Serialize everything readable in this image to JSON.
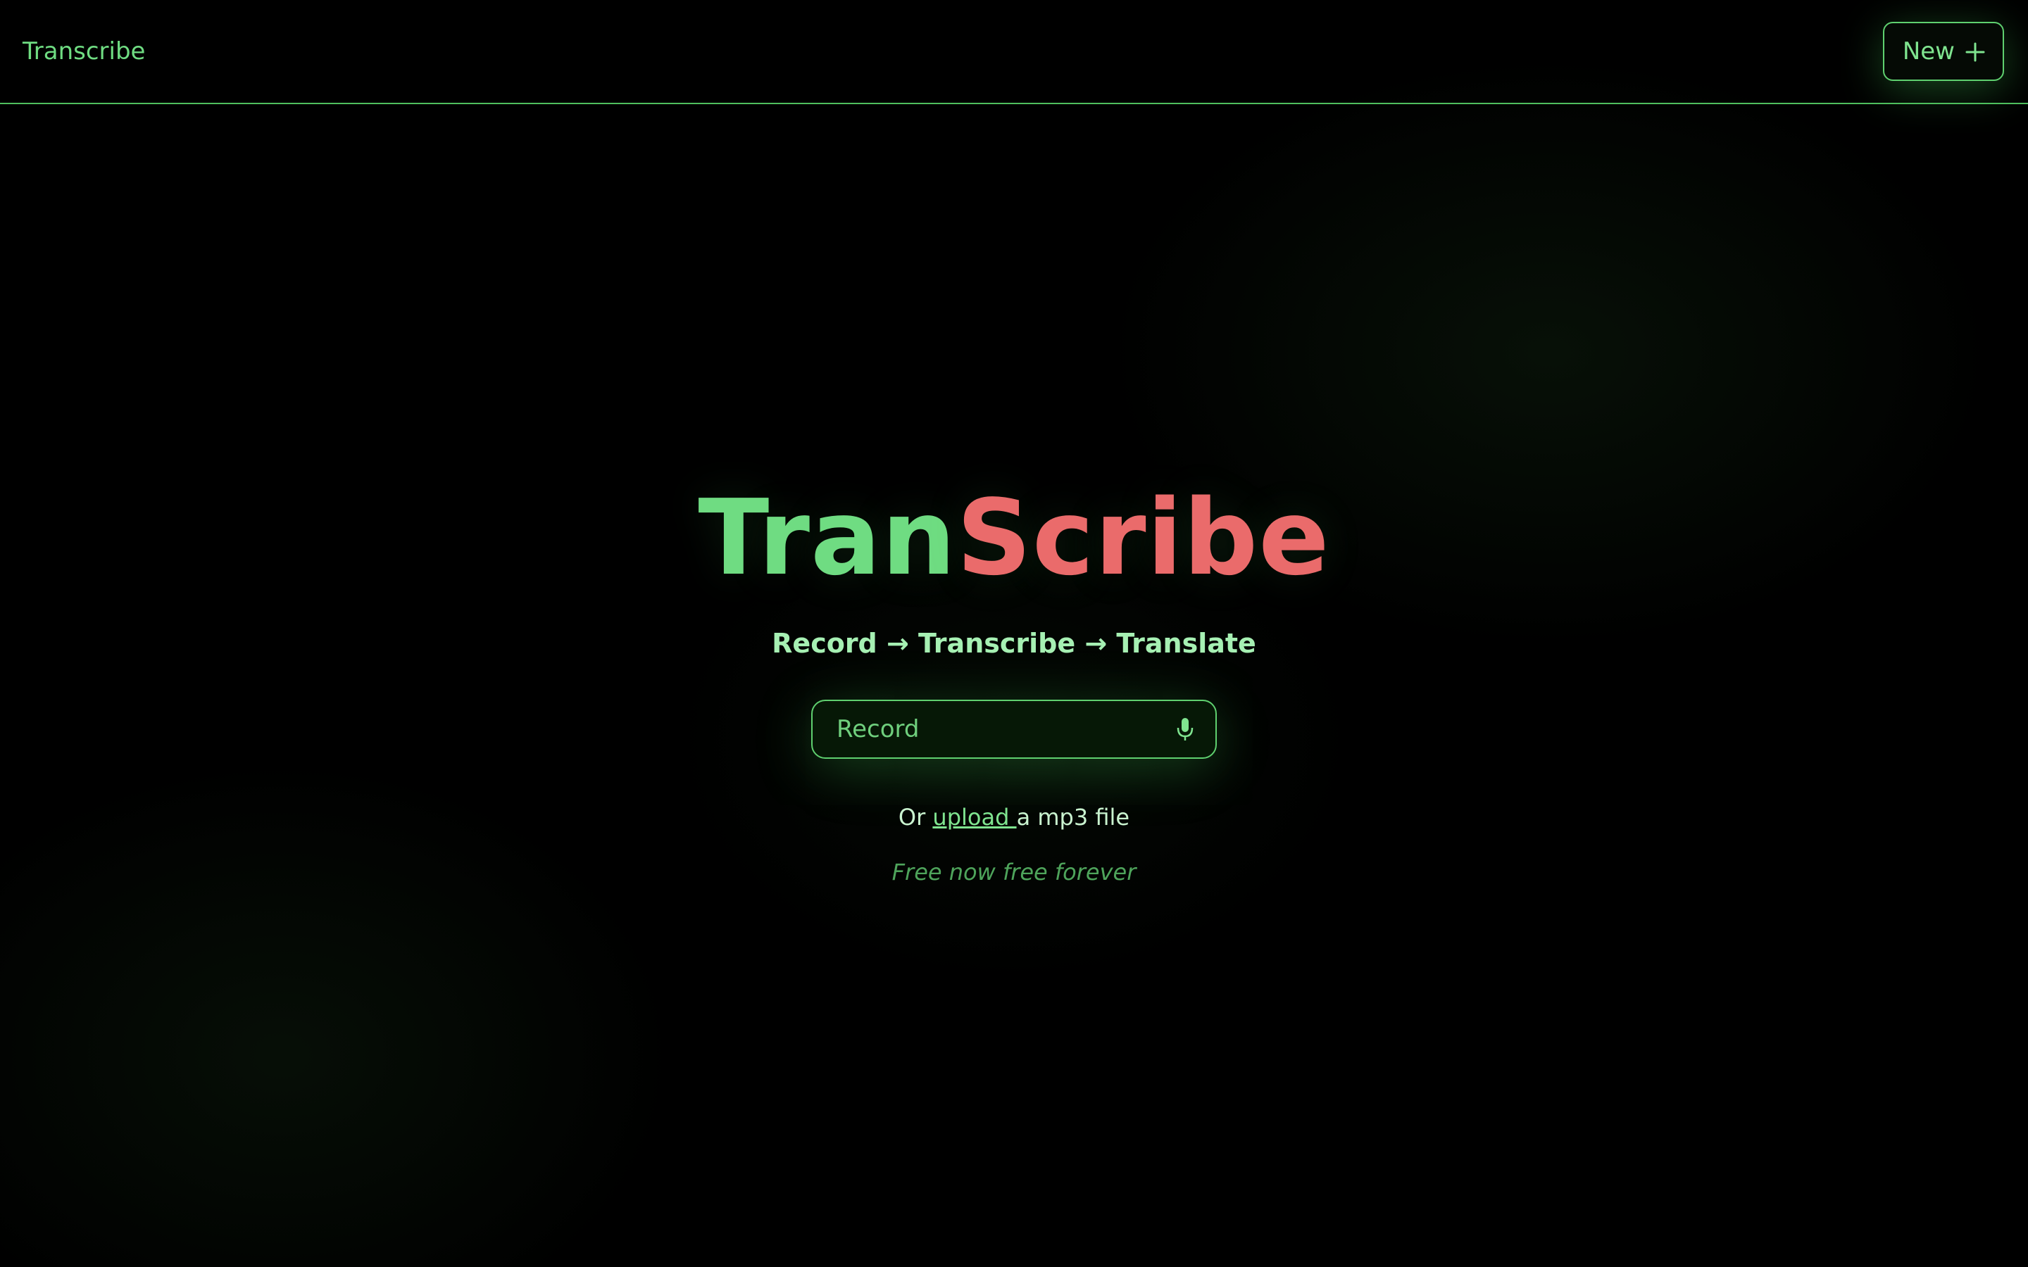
{
  "header": {
    "brand": "Transcribe",
    "new_button": {
      "label": "New"
    }
  },
  "hero": {
    "title_part1": "Tran",
    "title_part2": "Scribe",
    "subtitle": "Record → Transcribe → Translate",
    "record_button": {
      "label": "Record"
    },
    "upload": {
      "prefix": "Or ",
      "link": "upload ",
      "suffix": "a mp3 file"
    },
    "tagline": "Free now free forever"
  },
  "colors": {
    "accent_green": "#6fdc82",
    "accent_red": "#ea6b6b",
    "background": "#000000"
  },
  "icons": [
    "plus-icon",
    "microphone-icon"
  ]
}
